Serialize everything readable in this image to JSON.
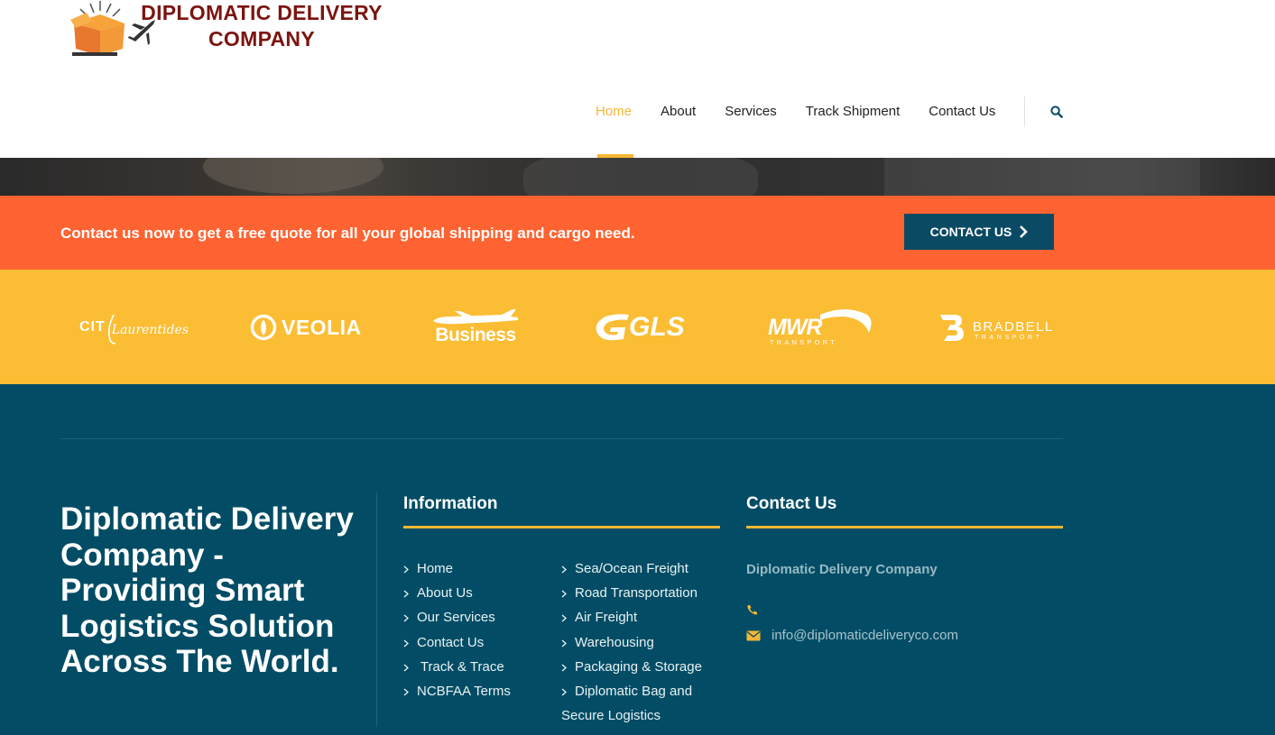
{
  "brand": {
    "name_line1": "DIPLOMATIC DELIVERY",
    "name_line2": "COMPANY",
    "logo_icon": "box-plane-logo"
  },
  "nav": {
    "items": [
      {
        "label": "Home",
        "active": true
      },
      {
        "label": "About",
        "active": false
      },
      {
        "label": "Services",
        "active": false
      },
      {
        "label": "Track Shipment",
        "active": false
      },
      {
        "label": "Contact Us",
        "active": false
      }
    ],
    "search_icon": "search-icon"
  },
  "cta": {
    "text": "Contact us now to get a free quote for all your global shipping and cargo need.",
    "button_label": "CONTACT US"
  },
  "partners": [
    {
      "name": "CIT Laurentides",
      "cit": "CIT",
      "script": "Laurentides"
    },
    {
      "name": "VEOLIA"
    },
    {
      "name": "Business"
    },
    {
      "name": "GLS"
    },
    {
      "name": "MWR",
      "sub": "TRANSPORT"
    },
    {
      "name": "BRADBELL",
      "sub": "TRANSPORT"
    }
  ],
  "footer": {
    "about": "Diplomatic Delivery Company - Providing Smart Logistics Solution Across The World.",
    "information": {
      "title": "Information",
      "col1": [
        "Home",
        "About Us",
        "Our Services",
        "Contact Us",
        " Track & Trace",
        "NCBFAA Terms"
      ],
      "col2": [
        "Sea/Ocean Freight",
        "Road Transportation",
        "Air Freight",
        "Warehousing",
        "Packaging & Storage",
        "Diplomatic Bag and"
      ],
      "col2_wrap": "Secure Logistics"
    },
    "contact": {
      "title": "Contact Us",
      "company": "Diplomatic Delivery Company",
      "phone": "",
      "email": "info@diplomaticdeliveryco.com"
    }
  },
  "colors": {
    "accent": "#f7b733",
    "cta_bg": "#ff6331",
    "brands_bg": "#fbbd34",
    "footer_bg": "#024d65",
    "button_bg": "#0b4a64",
    "logo_text": "#7b1410"
  }
}
